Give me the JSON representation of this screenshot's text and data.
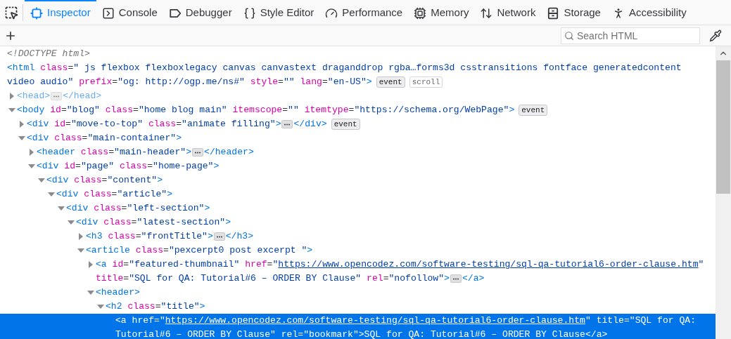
{
  "tabs": [
    {
      "label": "Inspector",
      "kind": "inspector",
      "selected": true
    },
    {
      "label": "Console",
      "kind": "console",
      "selected": false
    },
    {
      "label": "Debugger",
      "kind": "debugger",
      "selected": false
    },
    {
      "label": "Style Editor",
      "kind": "style",
      "selected": false
    },
    {
      "label": "Performance",
      "kind": "performance",
      "selected": false
    },
    {
      "label": "Memory",
      "kind": "memory",
      "selected": false
    },
    {
      "label": "Network",
      "kind": "network",
      "selected": false
    },
    {
      "label": "Storage",
      "kind": "storage",
      "selected": false
    },
    {
      "label": "Accessibility",
      "kind": "accessibility",
      "selected": false
    }
  ],
  "search": {
    "placeholder": "Search HTML"
  },
  "tree": [
    {
      "kind": "doctype",
      "tokens": [
        {
          "kind": "text",
          "text": "<!DOCTYPE html>"
        }
      ],
      "selected": false
    },
    {
      "kind": "element",
      "tokens": [
        {
          "kind": "tag",
          "text": "<html"
        },
        {
          "kind": "attr",
          "text": " class"
        },
        {
          "kind": "eq",
          "text": "="
        },
        {
          "kind": "value",
          "text": "\" js flexbox flexboxlegacy canvas canvastext draganddrop rgba…forms3d csstransitions fontface generatedcontent "
        },
        {
          "kind": "value",
          "text": "video audio\""
        },
        {
          "kind": "attr",
          "text": " prefix"
        },
        {
          "kind": "eq",
          "text": "="
        },
        {
          "kind": "value",
          "text": "\"og: http://ogp.me/ns#\""
        },
        {
          "kind": "attr",
          "text": " style"
        },
        {
          "kind": "eq",
          "text": "="
        },
        {
          "kind": "value",
          "text": "\"\""
        },
        {
          "kind": "attr",
          "text": " lang"
        },
        {
          "kind": "eq",
          "text": "="
        },
        {
          "kind": "value",
          "text": "\"en-US\""
        },
        {
          "kind": "tag",
          "text": ">"
        }
      ],
      "badges": [
        {
          "label": "event",
          "kind": "event"
        },
        {
          "label": "scroll",
          "kind": "layout"
        }
      ],
      "selected": false,
      "children": [
        {
          "kind": "element",
          "hidden": true,
          "expanded": false,
          "tokens": [
            {
              "kind": "tag",
              "text": "<head>"
            },
            {
              "kind": "more"
            },
            {
              "kind": "tag",
              "text": "</head>"
            }
          ],
          "selected": false
        },
        {
          "kind": "element",
          "expanded": true,
          "tokens": [
            {
              "kind": "tag",
              "text": "<body"
            },
            {
              "kind": "attr",
              "text": " id"
            },
            {
              "kind": "eq",
              "text": "="
            },
            {
              "kind": "value",
              "text": "\"blog\""
            },
            {
              "kind": "attr",
              "text": " class"
            },
            {
              "kind": "eq",
              "text": "="
            },
            {
              "kind": "value",
              "text": "\"home blog main\""
            },
            {
              "kind": "attr",
              "text": " itemscope"
            },
            {
              "kind": "eq",
              "text": "="
            },
            {
              "kind": "value",
              "text": "\"\""
            },
            {
              "kind": "attr",
              "text": " itemtype"
            },
            {
              "kind": "eq",
              "text": "="
            },
            {
              "kind": "value",
              "text": "\"https://schema.org/WebPage\""
            },
            {
              "kind": "tag",
              "text": ">"
            }
          ],
          "badges": [
            {
              "label": "event",
              "kind": "event"
            }
          ],
          "selected": false,
          "children": [
            {
              "kind": "element",
              "expanded": false,
              "tokens": [
                {
                  "kind": "tag",
                  "text": "<div"
                },
                {
                  "kind": "attr",
                  "text": " id"
                },
                {
                  "kind": "eq",
                  "text": "="
                },
                {
                  "kind": "value",
                  "text": "\"move-to-top\""
                },
                {
                  "kind": "attr",
                  "text": " class"
                },
                {
                  "kind": "eq",
                  "text": "="
                },
                {
                  "kind": "value",
                  "text": "\"animate filling\""
                },
                {
                  "kind": "tag",
                  "text": ">"
                },
                {
                  "kind": "more"
                },
                {
                  "kind": "tag",
                  "text": "</div>"
                }
              ],
              "badges": [
                {
                  "label": "event",
                  "kind": "event"
                }
              ],
              "selected": false
            },
            {
              "kind": "element",
              "expanded": true,
              "tokens": [
                {
                  "kind": "tag",
                  "text": "<div"
                },
                {
                  "kind": "attr",
                  "text": " class"
                },
                {
                  "kind": "eq",
                  "text": "="
                },
                {
                  "kind": "value",
                  "text": "\"main-container\""
                },
                {
                  "kind": "tag",
                  "text": ">"
                }
              ],
              "selected": false,
              "children": [
                {
                  "kind": "element",
                  "expanded": false,
                  "tokens": [
                    {
                      "kind": "tag",
                      "text": "<header"
                    },
                    {
                      "kind": "attr",
                      "text": " class"
                    },
                    {
                      "kind": "eq",
                      "text": "="
                    },
                    {
                      "kind": "value",
                      "text": "\"main-header\""
                    },
                    {
                      "kind": "tag",
                      "text": ">"
                    },
                    {
                      "kind": "more"
                    },
                    {
                      "kind": "tag",
                      "text": "</header>"
                    }
                  ],
                  "selected": false
                },
                {
                  "kind": "element",
                  "expanded": true,
                  "tokens": [
                    {
                      "kind": "tag",
                      "text": "<div"
                    },
                    {
                      "kind": "attr",
                      "text": " id"
                    },
                    {
                      "kind": "eq",
                      "text": "="
                    },
                    {
                      "kind": "value",
                      "text": "\"page\""
                    },
                    {
                      "kind": "attr",
                      "text": " class"
                    },
                    {
                      "kind": "eq",
                      "text": "="
                    },
                    {
                      "kind": "value",
                      "text": "\"home-page\""
                    },
                    {
                      "kind": "tag",
                      "text": ">"
                    }
                  ],
                  "selected": false,
                  "children": [
                    {
                      "kind": "element",
                      "expanded": true,
                      "tokens": [
                        {
                          "kind": "tag",
                          "text": "<div"
                        },
                        {
                          "kind": "attr",
                          "text": " class"
                        },
                        {
                          "kind": "eq",
                          "text": "="
                        },
                        {
                          "kind": "value",
                          "text": "\"content\""
                        },
                        {
                          "kind": "tag",
                          "text": ">"
                        }
                      ],
                      "selected": false,
                      "children": [
                        {
                          "kind": "element",
                          "expanded": true,
                          "tokens": [
                            {
                              "kind": "tag",
                              "text": "<div"
                            },
                            {
                              "kind": "attr",
                              "text": " class"
                            },
                            {
                              "kind": "eq",
                              "text": "="
                            },
                            {
                              "kind": "value",
                              "text": "\"article\""
                            },
                            {
                              "kind": "tag",
                              "text": ">"
                            }
                          ],
                          "selected": false,
                          "children": [
                            {
                              "kind": "element",
                              "expanded": true,
                              "tokens": [
                                {
                                  "kind": "tag",
                                  "text": "<div"
                                },
                                {
                                  "kind": "attr",
                                  "text": " class"
                                },
                                {
                                  "kind": "eq",
                                  "text": "="
                                },
                                {
                                  "kind": "value",
                                  "text": "\"left-section\""
                                },
                                {
                                  "kind": "tag",
                                  "text": ">"
                                }
                              ],
                              "selected": false,
                              "children": [
                                {
                                  "kind": "element",
                                  "expanded": true,
                                  "tokens": [
                                    {
                                      "kind": "tag",
                                      "text": "<div"
                                    },
                                    {
                                      "kind": "attr",
                                      "text": " class"
                                    },
                                    {
                                      "kind": "eq",
                                      "text": "="
                                    },
                                    {
                                      "kind": "value",
                                      "text": "\"latest-section\""
                                    },
                                    {
                                      "kind": "tag",
                                      "text": ">"
                                    }
                                  ],
                                  "selected": false,
                                  "children": [
                                    {
                                      "kind": "element",
                                      "expanded": false,
                                      "tokens": [
                                        {
                                          "kind": "tag",
                                          "text": "<h3"
                                        },
                                        {
                                          "kind": "attr",
                                          "text": " class"
                                        },
                                        {
                                          "kind": "eq",
                                          "text": "="
                                        },
                                        {
                                          "kind": "value",
                                          "text": "\"frontTitle\""
                                        },
                                        {
                                          "kind": "tag",
                                          "text": ">"
                                        },
                                        {
                                          "kind": "more"
                                        },
                                        {
                                          "kind": "tag",
                                          "text": "</h3>"
                                        }
                                      ],
                                      "selected": false
                                    },
                                    {
                                      "kind": "element",
                                      "expanded": true,
                                      "tokens": [
                                        {
                                          "kind": "tag",
                                          "text": "<article"
                                        },
                                        {
                                          "kind": "attr",
                                          "text": " class"
                                        },
                                        {
                                          "kind": "eq",
                                          "text": "="
                                        },
                                        {
                                          "kind": "value",
                                          "text": "\"pexcerpt0 post excerpt \""
                                        },
                                        {
                                          "kind": "tag",
                                          "text": ">"
                                        }
                                      ],
                                      "selected": false,
                                      "children": [
                                        {
                                          "kind": "element",
                                          "expanded": false,
                                          "tokens": [
                                            {
                                              "kind": "tag",
                                              "text": "<a"
                                            },
                                            {
                                              "kind": "attr",
                                              "text": " id"
                                            },
                                            {
                                              "kind": "eq",
                                              "text": "="
                                            },
                                            {
                                              "kind": "value",
                                              "text": "\"featured-thumbnail\""
                                            },
                                            {
                                              "kind": "attr",
                                              "text": " href"
                                            },
                                            {
                                              "kind": "eq",
                                              "text": "="
                                            },
                                            {
                                              "kind": "value",
                                              "text": "\""
                                            },
                                            {
                                              "kind": "link",
                                              "text": "https://www.opencodez.com/software-testing/sql-qa-tutorial6-order-clause.htm"
                                            },
                                            {
                                              "kind": "value",
                                              "text": "\" "
                                            },
                                            {
                                              "kind": "attr",
                                              "text": "title"
                                            },
                                            {
                                              "kind": "eq",
                                              "text": "="
                                            },
                                            {
                                              "kind": "value",
                                              "text": "\"SQL for QA: Tutorial#6 – ORDER BY Clause\""
                                            },
                                            {
                                              "kind": "attr",
                                              "text": " rel"
                                            },
                                            {
                                              "kind": "eq",
                                              "text": "="
                                            },
                                            {
                                              "kind": "value",
                                              "text": "\"nofollow\""
                                            },
                                            {
                                              "kind": "tag",
                                              "text": ">"
                                            },
                                            {
                                              "kind": "more"
                                            },
                                            {
                                              "kind": "tag",
                                              "text": "</a>"
                                            }
                                          ],
                                          "selected": false
                                        },
                                        {
                                          "kind": "element",
                                          "expanded": true,
                                          "tokens": [
                                            {
                                              "kind": "tag",
                                              "text": "<header>"
                                            }
                                          ],
                                          "selected": false,
                                          "children": [
                                            {
                                              "kind": "element",
                                              "expanded": true,
                                              "tokens": [
                                                {
                                                  "kind": "tag",
                                                  "text": "<h2"
                                                },
                                                {
                                                  "kind": "attr",
                                                  "text": " class"
                                                },
                                                {
                                                  "kind": "eq",
                                                  "text": "="
                                                },
                                                {
                                                  "kind": "value",
                                                  "text": "\"title\""
                                                },
                                                {
                                                  "kind": "tag",
                                                  "text": ">"
                                                }
                                              ],
                                              "selected": false,
                                              "children": [
                                                {
                                                  "kind": "element",
                                                  "tokens": [
                                                    {
                                                      "kind": "tag",
                                                      "text": "<a"
                                                    },
                                                    {
                                                      "kind": "attr",
                                                      "text": " href"
                                                    },
                                                    {
                                                      "kind": "eq",
                                                      "text": "="
                                                    },
                                                    {
                                                      "kind": "value",
                                                      "text": "\""
                                                    },
                                                    {
                                                      "kind": "link",
                                                      "text": "https://www.opencodez.com/software-testing/sql-qa-tutorial6-order-clause.htm"
                                                    },
                                                    {
                                                      "kind": "value",
                                                      "text": "\""
                                                    },
                                                    {
                                                      "kind": "attr",
                                                      "text": " title"
                                                    },
                                                    {
                                                      "kind": "eq",
                                                      "text": "="
                                                    },
                                                    {
                                                      "kind": "value",
                                                      "text": "\"SQL for QA: "
                                                    },
                                                    {
                                                      "kind": "value",
                                                      "text": "Tutorial#6 – ORDER BY Clause\""
                                                    },
                                                    {
                                                      "kind": "attr",
                                                      "text": " rel"
                                                    },
                                                    {
                                                      "kind": "eq",
                                                      "text": "="
                                                    },
                                                    {
                                                      "kind": "value",
                                                      "text": "\"bookmark\""
                                                    },
                                                    {
                                                      "kind": "tag",
                                                      "text": ">"
                                                    },
                                                    {
                                                      "kind": "text",
                                                      "text": "SQL for QA: Tutorial#6 – ORDER BY Clause"
                                                    },
                                                    {
                                                      "kind": "tag",
                                                      "text": "</a>"
                                                    }
                                                  ],
                                                  "selected": true
                                                }
                                              ]
                                            }
                                          ]
                                        }
                                      ]
                                    }
                                  ]
                                }
                              ]
                            }
                          ]
                        }
                      ]
                    }
                  ]
                }
              ]
            }
          ]
        }
      ]
    }
  ]
}
